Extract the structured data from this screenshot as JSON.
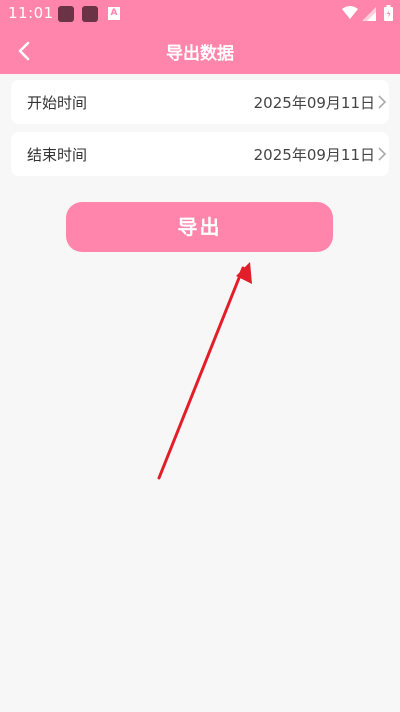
{
  "status_bar": {
    "time": "11:01",
    "notif_glyph": "A"
  },
  "app_bar": {
    "title": "导出数据"
  },
  "rows": [
    {
      "label": "开始时间",
      "value": "2025年09月11日"
    },
    {
      "label": "结束时间",
      "value": "2025年09月11日"
    }
  ],
  "export_button": {
    "label": "导出"
  },
  "colors": {
    "accent": "#ff85ad",
    "background": "#f7f7f7",
    "annotation_arrow": "#e01f2a"
  }
}
